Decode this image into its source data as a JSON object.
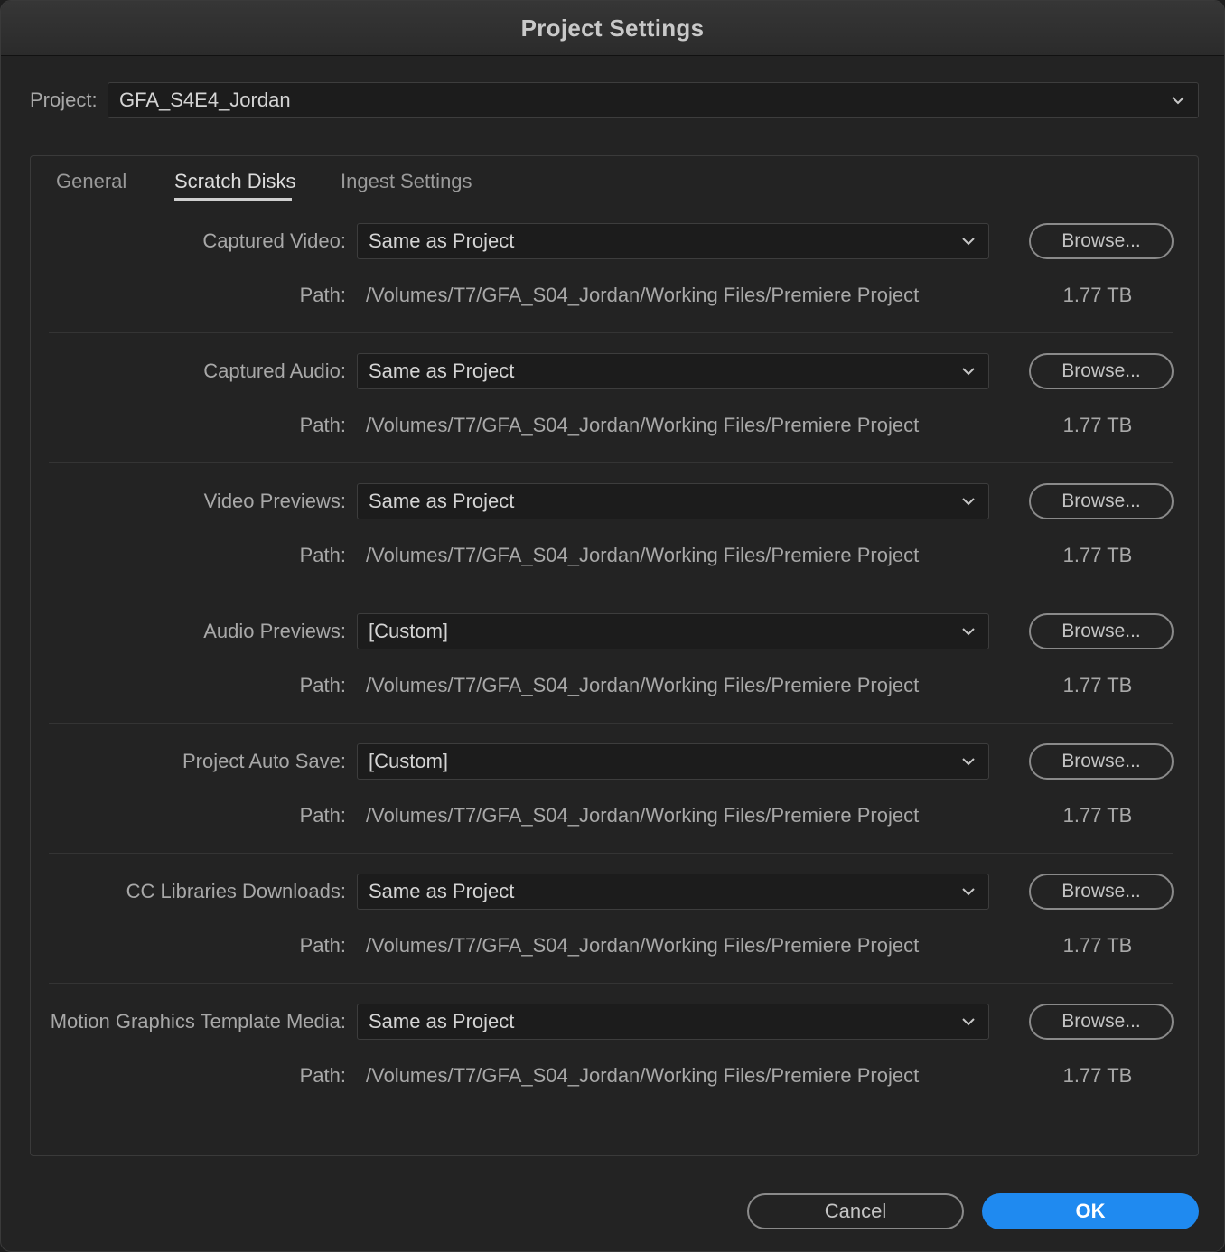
{
  "window": {
    "title": "Project Settings"
  },
  "project": {
    "label": "Project:",
    "selected": "GFA_S4E4_Jordan"
  },
  "tabs": [
    {
      "label": "General",
      "active": false
    },
    {
      "label": "Scratch Disks",
      "active": true
    },
    {
      "label": "Ingest Settings",
      "active": false
    }
  ],
  "scratch_disks": {
    "path_label": "Path:",
    "browse_label": "Browse...",
    "rows": [
      {
        "label": "Captured Video:",
        "selected": "Same as Project",
        "path": "/Volumes/T7/GFA_S04_Jordan/Working Files/Premiere Project",
        "size": "1.77 TB"
      },
      {
        "label": "Captured Audio:",
        "selected": "Same as Project",
        "path": "/Volumes/T7/GFA_S04_Jordan/Working Files/Premiere Project",
        "size": "1.77 TB"
      },
      {
        "label": "Video Previews:",
        "selected": "Same as Project",
        "path": "/Volumes/T7/GFA_S04_Jordan/Working Files/Premiere Project",
        "size": "1.77 TB"
      },
      {
        "label": "Audio Previews:",
        "selected": "[Custom]",
        "path": "/Volumes/T7/GFA_S04_Jordan/Working Files/Premiere Project",
        "size": "1.77 TB"
      },
      {
        "label": "Project Auto Save:",
        "selected": "[Custom]",
        "path": "/Volumes/T7/GFA_S04_Jordan/Working Files/Premiere Project",
        "size": "1.77 TB"
      },
      {
        "label": "CC Libraries Downloads:",
        "selected": "Same as Project",
        "path": "/Volumes/T7/GFA_S04_Jordan/Working Files/Premiere Project",
        "size": "1.77 TB"
      },
      {
        "label": "Motion Graphics Template Media:",
        "selected": "Same as Project",
        "path": "/Volumes/T7/GFA_S04_Jordan/Working Files/Premiere Project",
        "size": "1.77 TB"
      }
    ]
  },
  "footer": {
    "cancel_label": "Cancel",
    "ok_label": "OK"
  },
  "colors": {
    "accent": "#1f8af0",
    "background": "#232323"
  },
  "icons": {
    "dropdown": "chevron-down-icon"
  }
}
